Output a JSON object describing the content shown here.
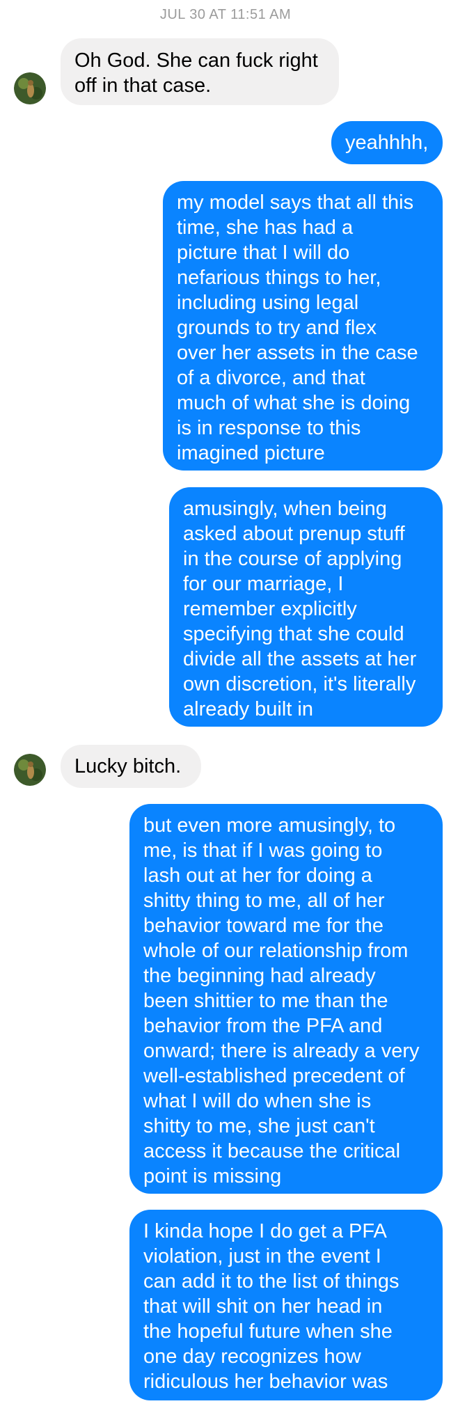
{
  "conversation": {
    "timestamp": "JUL 30 AT 11:51 AM",
    "messages": [
      {
        "sender": "them",
        "lines": [
          "Oh God. She can fuck right",
          "off in that case."
        ]
      },
      {
        "sender": "me",
        "lines": [
          "yeahhhh,"
        ]
      },
      {
        "sender": "me",
        "lines": [
          "my model says that all this",
          "time, she has had a",
          "picture that I will do",
          "nefarious things to her,",
          "including using legal",
          "grounds to try and flex",
          "over her assets in the case",
          "of a divorce, and that",
          "much of what she is doing",
          "is in response to this",
          "imagined picture"
        ]
      },
      {
        "sender": "me",
        "lines": [
          "amusingly, when being",
          "asked about prenup stuff",
          "in the course of applying",
          "for our marriage, I",
          "remember explicitly",
          "specifying that she could",
          "divide all the assets at her",
          "own discretion, it's literally",
          "already built in"
        ]
      },
      {
        "sender": "them",
        "lines": [
          "Lucky bitch."
        ]
      },
      {
        "sender": "me",
        "lines": [
          "but even more amusingly, to",
          "me, is that if I was going to",
          "lash out at her for doing a",
          "shitty thing to me, all of her",
          "behavior toward me for the",
          "whole of our relationship from",
          "the beginning had already",
          "been shittier to me than the",
          "behavior from the PFA and",
          "onward; there is already a very",
          "well-established precedent of",
          "what I will do when she is",
          "shitty to me, she just can't",
          "access it because the critical",
          "point is missing"
        ]
      },
      {
        "sender": "me",
        "lines": [
          "I kinda hope I do get a PFA",
          "violation, just in the event I",
          "can add it to the list of things",
          "that will shit on her head in",
          "the hopeful future when she",
          "one day recognizes how",
          "ridiculous her behavior was"
        ]
      }
    ]
  },
  "colors": {
    "incoming_bubble": "#f1f0f0",
    "outgoing_bubble": "#0a84ff",
    "timestamp_text": "#9b9b9b"
  },
  "icons": {
    "avatar": "contact-avatar-icon"
  }
}
